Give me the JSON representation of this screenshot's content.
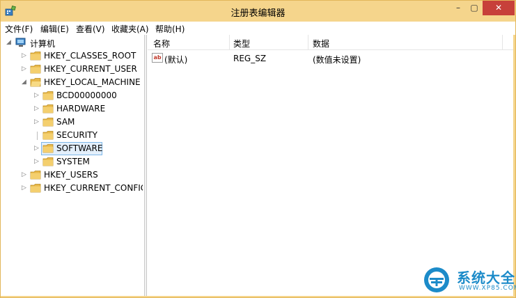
{
  "window": {
    "title": "注册表编辑器",
    "min_symbol": "–",
    "max_symbol": "▢",
    "close_symbol": "✕"
  },
  "menu": [
    {
      "label": "文件(F)"
    },
    {
      "label": "编辑(E)"
    },
    {
      "label": "查看(V)"
    },
    {
      "label": "收藏夹(A)"
    },
    {
      "label": "帮助(H)"
    }
  ],
  "tree": {
    "root": "计算机",
    "items": [
      {
        "label": "HKEY_CLASSES_ROOT",
        "expanded": false
      },
      {
        "label": "HKEY_CURRENT_USER",
        "expanded": false
      },
      {
        "label": "HKEY_LOCAL_MACHINE",
        "expanded": true
      },
      {
        "label": "BCD00000000",
        "expanded": false
      },
      {
        "label": "HARDWARE",
        "expanded": false
      },
      {
        "label": "SAM",
        "expanded": false
      },
      {
        "label": "SECURITY",
        "expanded": false
      },
      {
        "label": "SOFTWARE",
        "expanded": false,
        "selected": true
      },
      {
        "label": "SYSTEM",
        "expanded": false
      },
      {
        "label": "HKEY_USERS",
        "expanded": false
      },
      {
        "label": "HKEY_CURRENT_CONFIG",
        "expanded": false
      }
    ]
  },
  "list": {
    "columns": [
      "名称",
      "类型",
      "数据"
    ],
    "rows": [
      {
        "name": "(默认)",
        "type": "REG_SZ",
        "data": "(数值未设置)",
        "icon": "ab"
      }
    ]
  },
  "watermark": {
    "brand": "系统大全",
    "url": "WWW.XP85.COM"
  },
  "colors": {
    "titlebar": "#f5d58c",
    "close": "#c7403a",
    "folder": "#e8b84a",
    "selection": "#e3effb",
    "brand": "#1c8bc9"
  }
}
